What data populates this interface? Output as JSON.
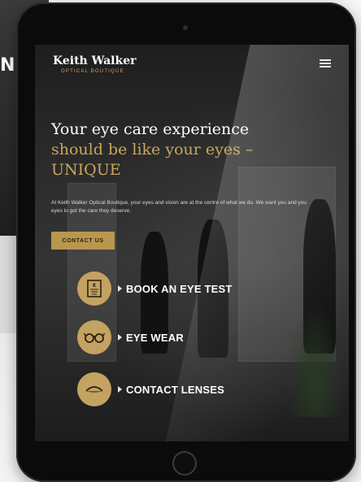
{
  "background_site": {
    "partial_text": "NS"
  },
  "brand": {
    "name": "Keith Walker",
    "tagline": "OPTICAL BOUTIQUE"
  },
  "hero": {
    "headline_line1": "Your eye care experience",
    "headline_line2": "should be like your eyes –",
    "headline_line3": "UNIQUE",
    "intro": "At Keith Walker Optical Boutique, your eyes and vision are at the centre of what we do. We want you and you eyes to get the care they deserve.",
    "cta_label": "CONTACT US"
  },
  "services": [
    {
      "label": "BOOK AN EYE TEST",
      "icon": "eye-chart-icon"
    },
    {
      "label": "EYE WEAR",
      "icon": "glasses-icon"
    },
    {
      "label": "CONTACT LENSES",
      "icon": "contact-lens-icon"
    }
  ],
  "colors": {
    "accent": "#c9a75d",
    "button": "#b9974e",
    "icon_circle": "#c4a262",
    "frame": "#0b0b0b"
  }
}
